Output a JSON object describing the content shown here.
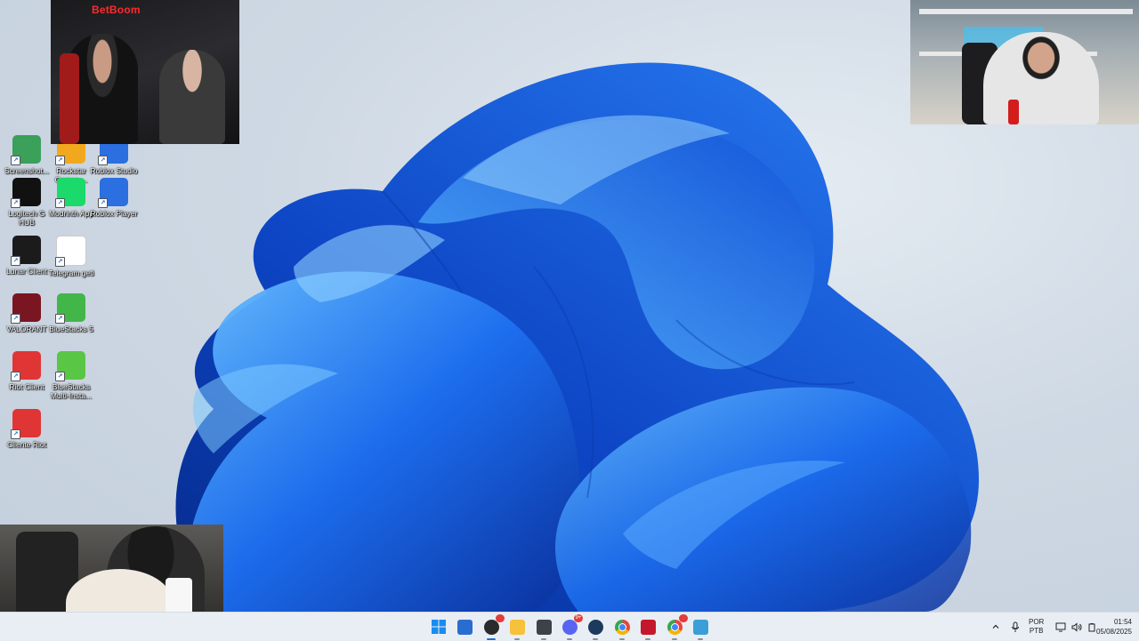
{
  "desktop": {
    "icons": [
      {
        "label": "Screenshot...",
        "icon": "screenshot-folder-icon",
        "color": "#3aa05a"
      },
      {
        "label": "Rockstar Games ...",
        "icon": "rockstar-games-icon",
        "color": "#f2a81e"
      },
      {
        "label": "Roblox Studio",
        "icon": "roblox-studio-icon",
        "color": "#2b6fe0"
      },
      {
        "label": "Logitech G HUB",
        "icon": "logitech-g-hub-icon",
        "color": "#111111"
      },
      {
        "label": "Modrinth App",
        "icon": "modrinth-app-icon",
        "color": "#1bd96a"
      },
      {
        "label": "Roblox Player",
        "icon": "roblox-player-icon",
        "color": "#2b6fe0"
      },
      {
        "label": "Lunar Client",
        "icon": "lunar-client-icon",
        "color": "#1b1b1b"
      },
      {
        "label": "Telegram geti",
        "icon": "telegram-video-icon",
        "color": "#ffffff"
      },
      {
        "label": "VALORANT",
        "icon": "valorant-icon",
        "color": "#7a1622"
      },
      {
        "label": "BlueStacks 5",
        "icon": "bluestacks-5-icon",
        "color": "#43b649"
      },
      {
        "label": "Riot Client",
        "icon": "riot-client-icon",
        "color": "#e03535"
      },
      {
        "label": "BlueStacks Multi-Insta...",
        "icon": "bluestacks-multi-instance-icon",
        "color": "#59c645"
      },
      {
        "label": "Cliente Riot",
        "icon": "cliente-riot-icon",
        "color": "#e03535"
      }
    ]
  },
  "webcams": {
    "top_left": {
      "brand": "BetBoom"
    },
    "top_right": {},
    "bottom_left": {}
  },
  "taskbar": {
    "apps": [
      {
        "name": "start",
        "icon": "windows-start-icon",
        "color": "#1a8cf0"
      },
      {
        "name": "microsoft-store",
        "icon": "microsoft-store-icon",
        "color": "#2a6dd0"
      },
      {
        "name": "obs",
        "icon": "obs-studio-icon",
        "color": "#2b2b2b",
        "badge": "",
        "running": true,
        "active": true
      },
      {
        "name": "file-explorer",
        "icon": "folder-icon",
        "color": "#f5c23a",
        "running": true
      },
      {
        "name": "terminal",
        "icon": "terminal-icon",
        "color": "#3d4148",
        "running": true
      },
      {
        "name": "discord",
        "icon": "discord-icon",
        "color": "#5865f2",
        "badge": "9+",
        "running": true
      },
      {
        "name": "steam",
        "icon": "steam-icon",
        "color": "#1b3a5e",
        "running": true
      },
      {
        "name": "chrome",
        "icon": "chrome-icon",
        "color": "#e8453c",
        "running": true
      },
      {
        "name": "among-us",
        "icon": "among-us-icon",
        "color": "#c5172b",
        "running": true
      },
      {
        "name": "chrome-2",
        "icon": "chrome-icon",
        "color": "#e8453c",
        "badge": "",
        "running": true
      },
      {
        "name": "notepad",
        "icon": "notepad-icon",
        "color": "#3a9fd6",
        "running": true
      }
    ],
    "tray": {
      "lang_top": "POR",
      "lang_bottom": "PTB",
      "time": "01:54",
      "date": "05/08/2025"
    }
  },
  "colors": {
    "taskbar_bg": "#e9eef4",
    "accent": "#1a6fd6",
    "bloom_dark": "#0b3fb8",
    "bloom_light": "#3aa0ff"
  }
}
